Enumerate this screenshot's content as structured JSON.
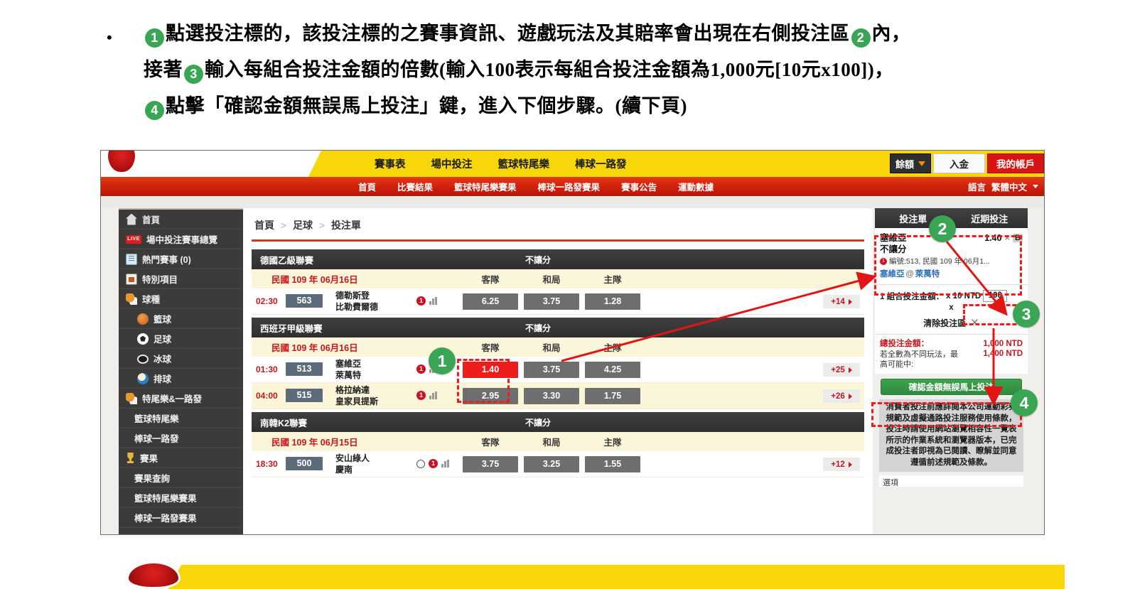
{
  "slide": {
    "bullet": "•",
    "line1_a": "點選投注標的，該投注標的之賽事資訊、遊戲玩法及其賠率會出現在右側投注區",
    "line1_b": "內，",
    "line2_a": "接著",
    "line2_b": "輸入每組合投注金額的倍數(輸入100表示每組合投注金額為1,000元[10元x100])，",
    "line3_a": "點擊「確認金額無誤馬上投注」鍵，進入下個步驟。(續下頁)",
    "badge1": "1",
    "badge2": "2",
    "badge3": "3",
    "badge4": "4"
  },
  "annotations": {
    "n1": "1",
    "n2": "2",
    "n3": "3",
    "n4": "4",
    "accent_green": "#3aa655",
    "accent_red": "#ee1c1c"
  },
  "topbar": {
    "nav": [
      "賽事表",
      "場中投注",
      "籃球特尾樂",
      "棒球一路發"
    ],
    "balance_label": "餘額",
    "deposit_label": "入金",
    "account_label": "我的帳戶"
  },
  "subnav": {
    "links": [
      "首頁",
      "比賽結果",
      "籃球特尾樂賽果",
      "棒球一路發賽果",
      "賽事公告",
      "運動數據"
    ],
    "lang_label": "語言",
    "lang_value": "繁體中文"
  },
  "sidebar": {
    "items": [
      {
        "label": "首頁",
        "icon": "home-icon",
        "type": "top"
      },
      {
        "label": "場中投注賽事總覽",
        "icon": "live-icon",
        "type": "top"
      },
      {
        "label": "熱門賽事 (0)",
        "icon": "clipboard-icon",
        "type": "top"
      },
      {
        "label": "特別項目",
        "icon": "calendar-icon",
        "type": "top"
      },
      {
        "label": "球種",
        "icon": "balls-icon",
        "type": "top"
      },
      {
        "label": "籃球",
        "icon": "basketball-icon",
        "type": "sub"
      },
      {
        "label": "足球",
        "icon": "soccer-icon",
        "type": "sub"
      },
      {
        "label": "冰球",
        "icon": "hockey-icon",
        "type": "sub"
      },
      {
        "label": "排球",
        "icon": "volleyball-icon",
        "type": "sub"
      },
      {
        "label": "特尾樂&一路發",
        "icon": "balls-icon",
        "type": "top"
      },
      {
        "label": "籃球特尾樂",
        "icon": "",
        "type": "plain"
      },
      {
        "label": "棒球一路發",
        "icon": "",
        "type": "plain"
      },
      {
        "label": "賽果",
        "icon": "trophy-icon",
        "type": "top"
      },
      {
        "label": "賽果查詢",
        "icon": "",
        "type": "plain"
      },
      {
        "label": "籃球特尾樂賽果",
        "icon": "",
        "type": "plain"
      },
      {
        "label": "棒球一路發賽果",
        "icon": "",
        "type": "plain"
      }
    ]
  },
  "breadcrumb": {
    "items": [
      "首頁",
      "足球",
      "投注單"
    ],
    "separator": ">"
  },
  "leagues": [
    {
      "name": "德國乙級聯賽",
      "handicap": "不讓分",
      "date": "民國 109 年 06月16日",
      "columns": [
        "客隊",
        "和局",
        "主隊"
      ],
      "matches": [
        {
          "time": "02:30",
          "id": "563",
          "team_away": "德勒斯登",
          "team_home": "比勒費爾德",
          "markers": [
            "badge-1",
            "chart-icon"
          ],
          "odds": [
            "6.25",
            "3.75",
            "1.28"
          ],
          "selected": -1,
          "more": "+14",
          "tint": false
        }
      ]
    },
    {
      "name": "西班牙甲級聯賽",
      "handicap": "不讓分",
      "date": "民國 109 年 06月16日",
      "columns": [
        "客隊",
        "和局",
        "主隊"
      ],
      "matches": [
        {
          "time": "01:30",
          "id": "513",
          "team_away": "塞維亞",
          "team_home": "萊萬特",
          "markers": [
            "badge-1",
            "chart-icon"
          ],
          "odds": [
            "1.40",
            "3.75",
            "4.25"
          ],
          "selected": 0,
          "more": "+25",
          "tint": false
        },
        {
          "time": "04:00",
          "id": "515",
          "team_away": "格拉納達",
          "team_home": "皇家貝提斯",
          "markers": [
            "badge-1",
            "chart-icon"
          ],
          "odds": [
            "2.95",
            "3.30",
            "1.75"
          ],
          "selected": -1,
          "more": "+26",
          "tint": true
        }
      ]
    },
    {
      "name": "南韓K2聯賽",
      "handicap": "不讓分",
      "date": "民國 109 年 06月15日",
      "columns": [
        "客隊",
        "和局",
        "主隊"
      ],
      "matches": [
        {
          "time": "18:30",
          "id": "500",
          "team_away": "安山綠人",
          "team_home": "慶南",
          "markers": [
            "stopwatch-icon",
            "badge-1",
            "chart-icon"
          ],
          "odds": [
            "3.75",
            "3.25",
            "1.55"
          ],
          "selected": -1,
          "more": "+12",
          "tint": false
        }
      ]
    }
  ],
  "slip": {
    "tab_active": "投注單",
    "tab_other": "近期投注",
    "selection": {
      "team": "塞維亞",
      "market": "不讓分",
      "odds": "1.40",
      "multiply": "×",
      "type_code": "B",
      "meta_badge": "1",
      "meta": "編號:513, 民國 109 年 06月1...",
      "match_away": "塞維亞",
      "match_at": "@",
      "match_home": "萊萬特"
    },
    "amount": {
      "combo_label": "1 組合投注金額：",
      "unit_label": "x 10 NTD",
      "multiplier": "100",
      "x_symbol": "x",
      "clear_label": "清除投注區",
      "clear_icon": "✕"
    },
    "totals": {
      "total_label": "總投注金額：",
      "total_value": "1,000 NTD",
      "max_note": "若全數為不同玩法，最高可能中:",
      "max_value": "1,400 NTD"
    },
    "confirm_label": "確認金額無誤馬上投注",
    "terms": "消費者投注前應詳閱本公司運動彩券規範及虛擬通路投注服務使用條款，投注時請使用網站瀏覽相容性一覽表所示的作業系統和瀏覽器版本，已完成投注者即視為已閱讀、瞭解並同意遵循前述規範及條款。",
    "options_label": "選項"
  }
}
